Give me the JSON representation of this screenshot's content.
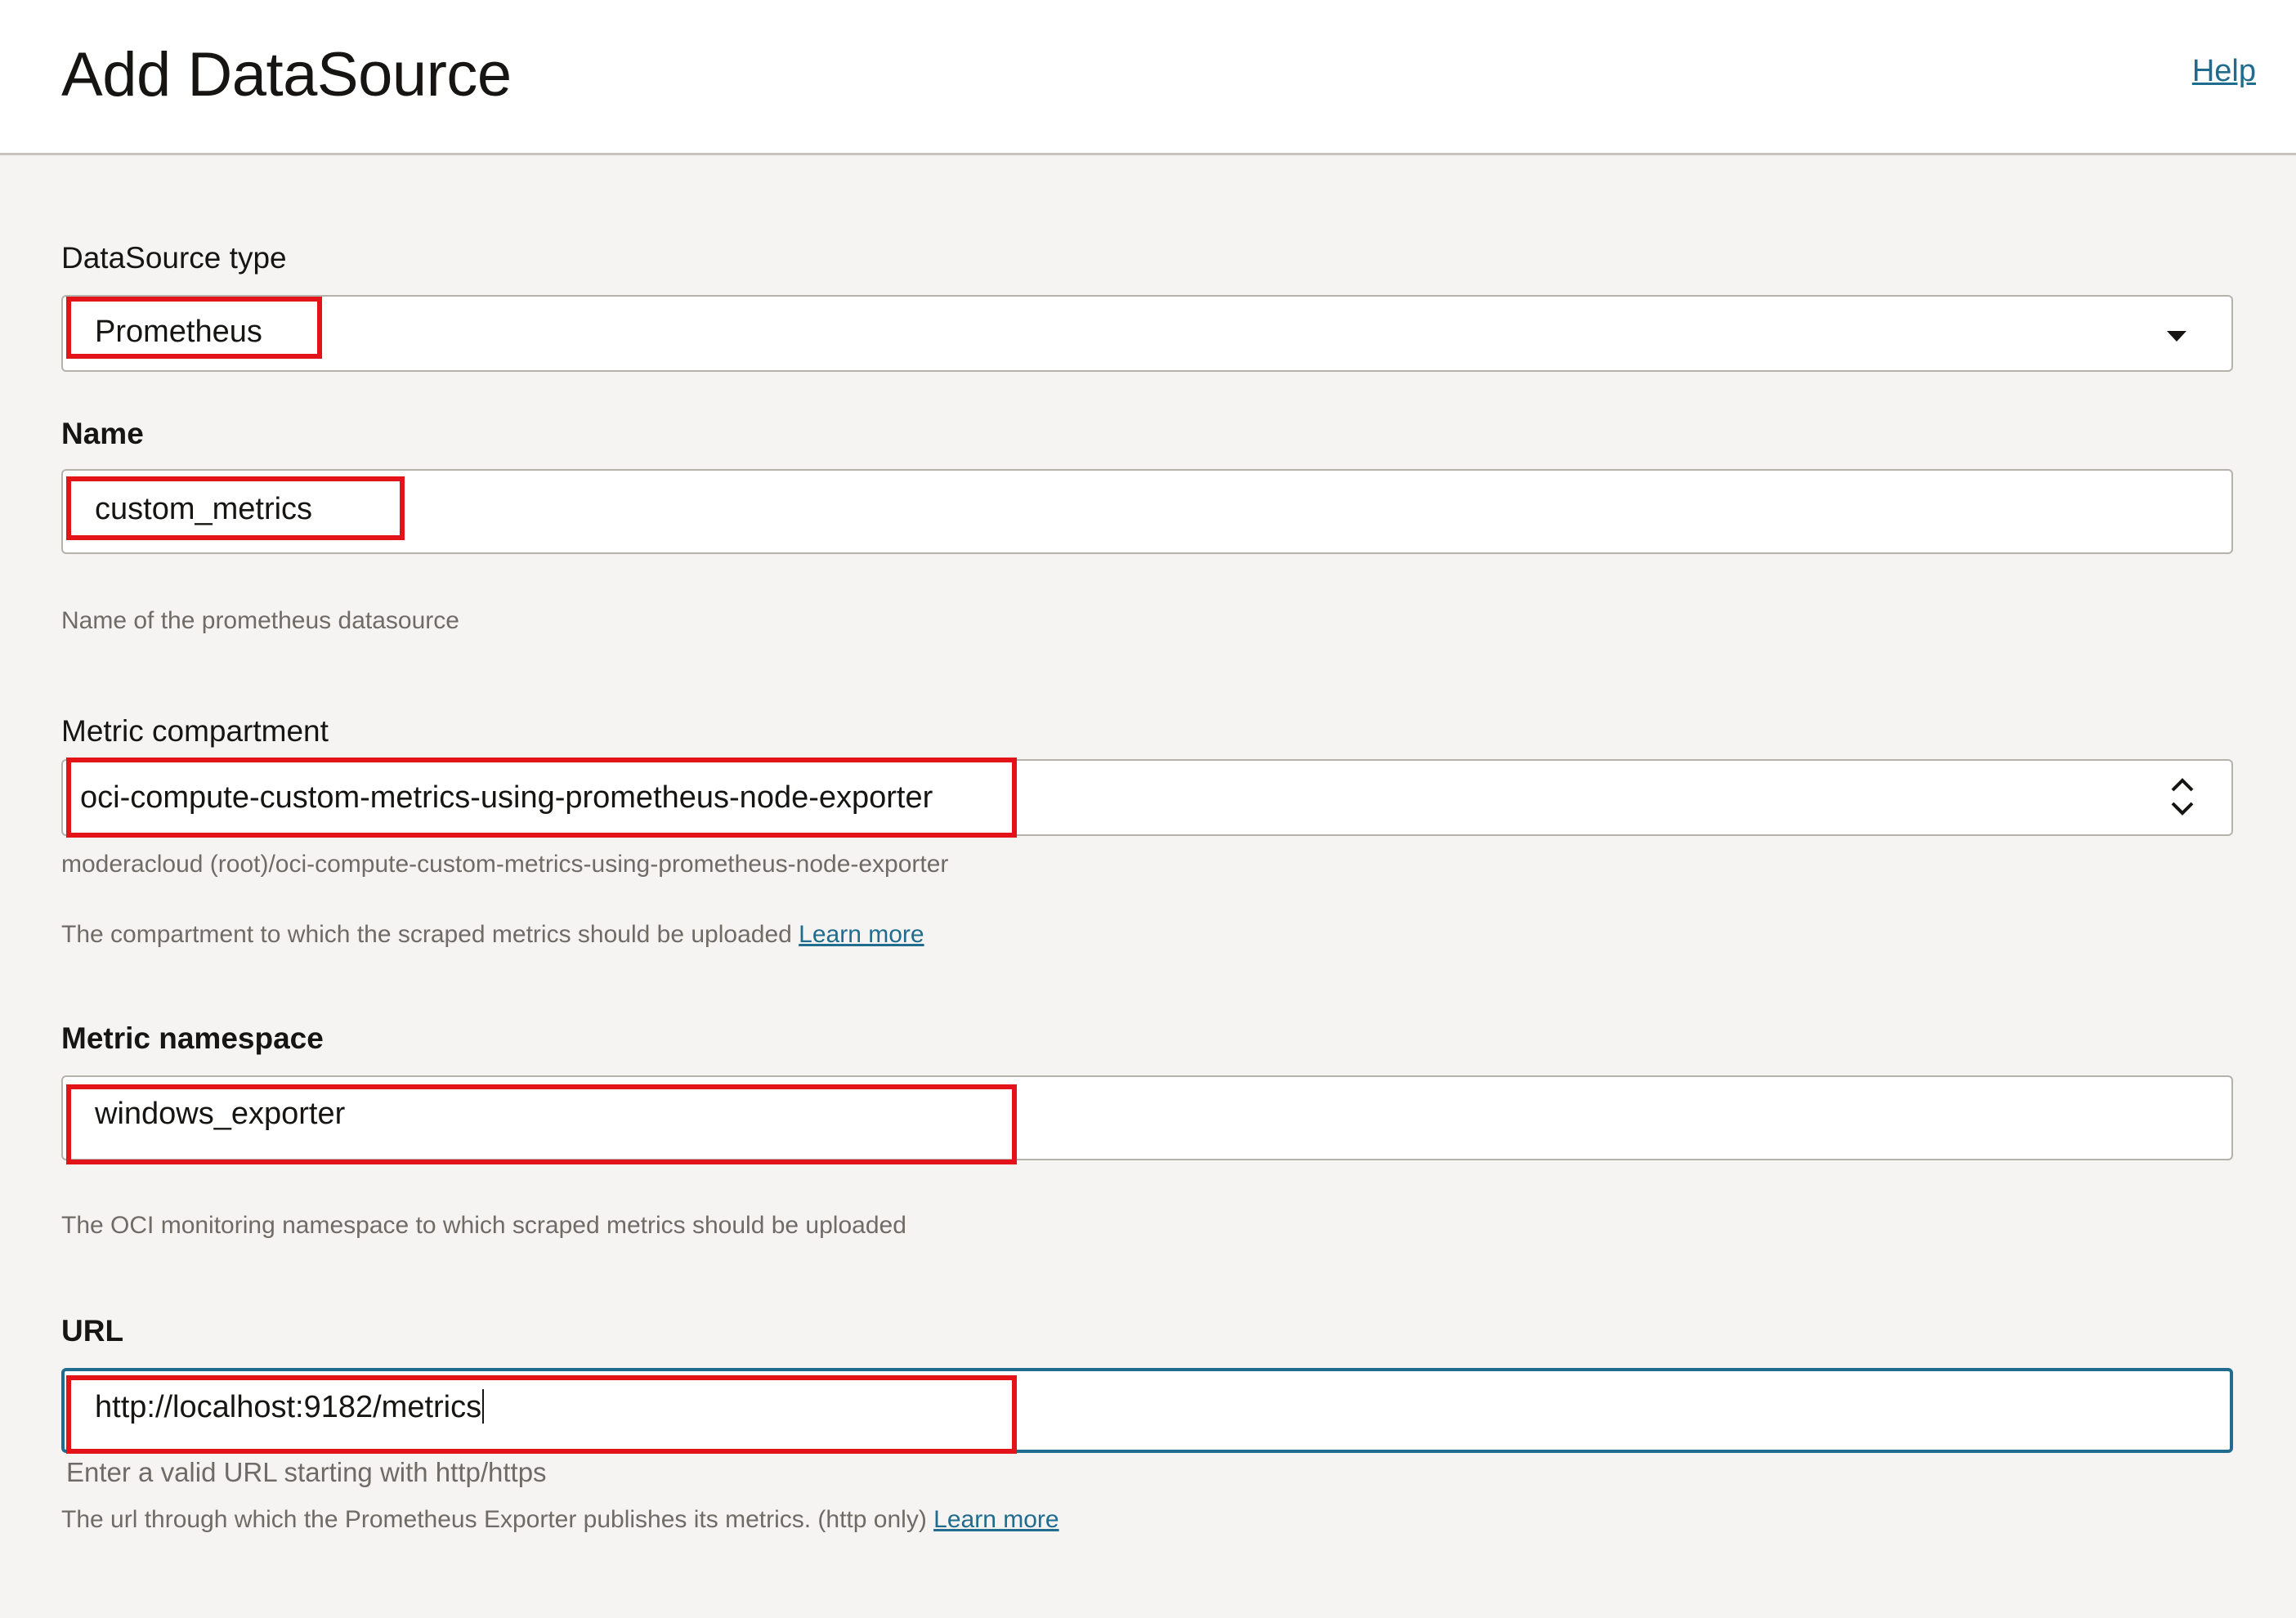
{
  "header": {
    "title": "Add DataSource",
    "help_label": "Help"
  },
  "datasource_type": {
    "label": "DataSource type",
    "value": "Prometheus"
  },
  "name": {
    "label": "Name",
    "value": "custom_metrics",
    "help": "Name of the prometheus datasource"
  },
  "metric_compartment": {
    "label": "Metric compartment",
    "value": "oci-compute-custom-metrics-using-prometheus-node-exporter",
    "path": "moderacloud (root)/oci-compute-custom-metrics-using-prometheus-node-exporter",
    "help": "The compartment to which the scraped metrics should be uploaded",
    "learn_more": "Learn more"
  },
  "metric_namespace": {
    "label": "Metric namespace",
    "value": "windows_exporter",
    "help": "The OCI monitoring namespace to which scraped metrics should be uploaded"
  },
  "url": {
    "label": "URL",
    "value": "http://localhost:9182/metrics",
    "validation": "Enter a valid URL starting with http/https",
    "help": "The url through which the Prometheus Exporter publishes its metrics. (http only)",
    "learn_more": "Learn more"
  },
  "colors": {
    "highlight": "#e2141a",
    "link": "#1f6c8f",
    "background": "#f5f4f2"
  }
}
